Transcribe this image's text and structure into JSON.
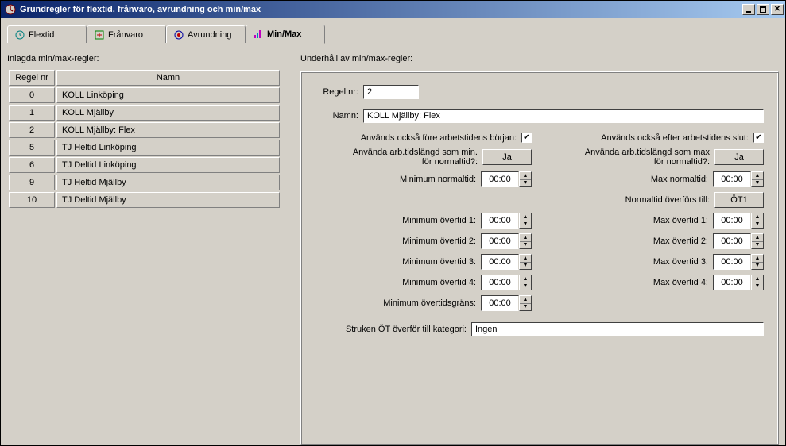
{
  "window": {
    "title": "Grundregler för flextid, frånvaro, avrundning och min/max"
  },
  "tabs": {
    "flextid": "Flextid",
    "franvaro": "Frånvaro",
    "avrundning": "Avrundning",
    "minmax": "Min/Max"
  },
  "left": {
    "heading": "Inlagda min/max-regler:",
    "col_nr": "Regel nr",
    "col_name": "Namn",
    "rows": [
      {
        "nr": "0",
        "name": "KOLL Linköping"
      },
      {
        "nr": "1",
        "name": "KOLL Mjällby"
      },
      {
        "nr": "2",
        "name": "KOLL Mjällby: Flex"
      },
      {
        "nr": "5",
        "name": "TJ Heltid Linköping"
      },
      {
        "nr": "6",
        "name": "TJ Deltid Linköping"
      },
      {
        "nr": "9",
        "name": "TJ Heltid Mjällby"
      },
      {
        "nr": "10",
        "name": "TJ Deltid Mjällby"
      }
    ]
  },
  "right": {
    "heading": "Underhåll av min/max-regler:",
    "regel_nr_label": "Regel nr:",
    "regel_nr_value": "2",
    "namn_label": "Namn:",
    "namn_value": "KOLL Mjällby: Flex",
    "before_label": "Används också före arbetstidens början:",
    "after_label": "Används också efter arbetstidens slut:",
    "check_glyph": "✔",
    "min_norm_q": "Använda arb.tidslängd som min. för normaltid?:",
    "max_norm_q": "Använda arb.tidslängd som max för normaltid?:",
    "yes": "Ja",
    "min_norm_label": "Minimum normaltid:",
    "max_norm_label": "Max normaltid:",
    "norm_transfer_label": "Normaltid överförs till:",
    "norm_transfer_value": "ÖT1",
    "min_ot1": "Minimum övertid 1:",
    "max_ot1": "Max övertid 1:",
    "min_ot2": "Minimum övertid 2:",
    "max_ot2": "Max övertid 2:",
    "min_ot3": "Minimum övertid 3:",
    "max_ot3": "Max övertid 3:",
    "min_ot4": "Minimum övertid 4:",
    "max_ot4": "Max övertid 4:",
    "min_ot_limit": "Minimum övertidsgräns:",
    "time_zero": "00:00",
    "struken_label": "Struken ÖT överför till kategori:",
    "struken_value": "Ingen"
  }
}
